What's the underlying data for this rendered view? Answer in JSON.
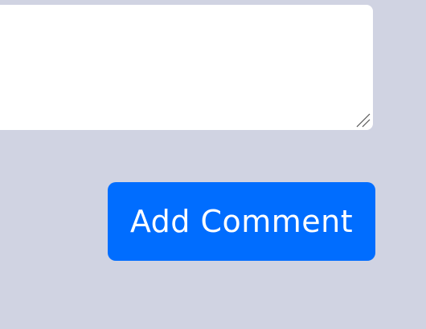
{
  "comment": {
    "value": "",
    "placeholder": ""
  },
  "actions": {
    "add_comment_label": "Add Comment"
  },
  "colors": {
    "background": "#d0d3e2",
    "textarea_background": "#ffffff",
    "button_background": "#006dff",
    "button_text": "#ffffff"
  }
}
